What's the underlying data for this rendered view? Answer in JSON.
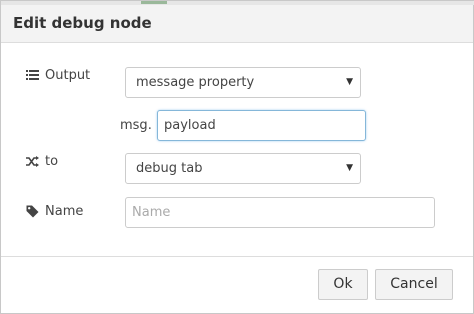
{
  "dialog": {
    "title": "Edit debug node"
  },
  "fields": {
    "output": {
      "label": "Output",
      "icon": "list-icon",
      "value": "message property"
    },
    "property": {
      "prefix": "msg.",
      "value": "payload"
    },
    "to": {
      "label": "to",
      "icon": "random-icon",
      "value": "debug tab"
    },
    "name": {
      "label": "Name",
      "icon": "tag-icon",
      "value": "",
      "placeholder": "Name"
    }
  },
  "footer": {
    "ok_label": "Ok",
    "cancel_label": "Cancel"
  },
  "colors": {
    "focus_border": "#85b7d9",
    "button_bg": "#f3f3f3",
    "title_bg": "#f3f3f3"
  }
}
